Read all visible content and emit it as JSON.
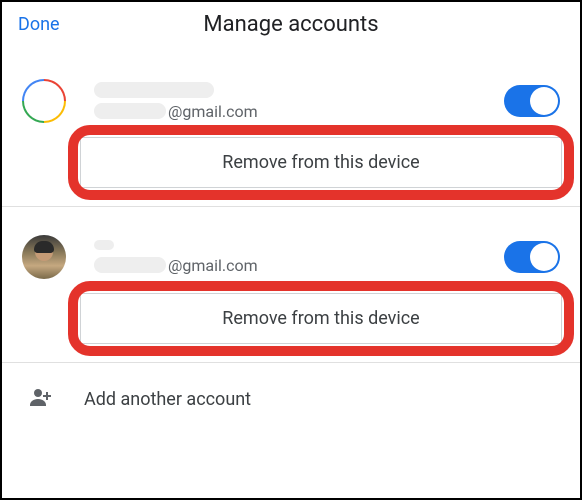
{
  "header": {
    "done": "Done",
    "title": "Manage accounts"
  },
  "accounts": [
    {
      "email_domain": "@gmail.com",
      "toggle_on": true,
      "remove_label": "Remove from this device"
    },
    {
      "email_domain": "@gmail.com",
      "toggle_on": true,
      "remove_label": "Remove from this device"
    }
  ],
  "add_row": {
    "label": "Add another account"
  },
  "colors": {
    "accent": "#1a73e8",
    "highlight": "#e4332b"
  }
}
